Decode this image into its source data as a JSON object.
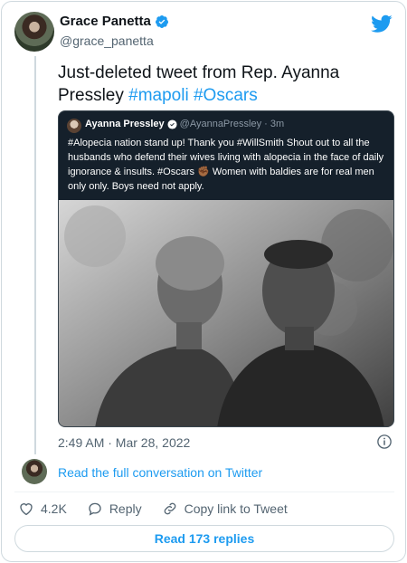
{
  "author": {
    "display_name": "Grace Panetta",
    "handle": "@grace_panetta",
    "avatar_icon": "user-avatar",
    "verified_icon": "verified-badge-icon"
  },
  "brand": {
    "logo_icon": "twitter-bird-icon",
    "accent": "#1d9bf0"
  },
  "tweet": {
    "text_prefix": "Just-deleted tweet from Rep. Ayanna Pressley ",
    "hashtag1": "#mapoli",
    "hashtag2": "#Oscars",
    "timestamp": "2:49 AM · Mar 28, 2022"
  },
  "quoted": {
    "name": "Ayanna Pressley",
    "handle": "@AyannaPressley",
    "time": "· 3m",
    "text": "#Alopecia nation stand up! Thank you #WillSmith Shout out to all the husbands who defend their wives living with alopecia in the face of daily ignorance & insults. #Oscars ✊🏾 Women with baldies are for real men only only. Boys need not apply.",
    "background": "#15202b"
  },
  "conversation": {
    "link_text": "Read the full conversation on Twitter"
  },
  "actions": {
    "like_count": "4.2K",
    "reply_label": "Reply",
    "copy_label": "Copy link to Tweet"
  },
  "replies_button": {
    "label": "Read 173 replies"
  }
}
